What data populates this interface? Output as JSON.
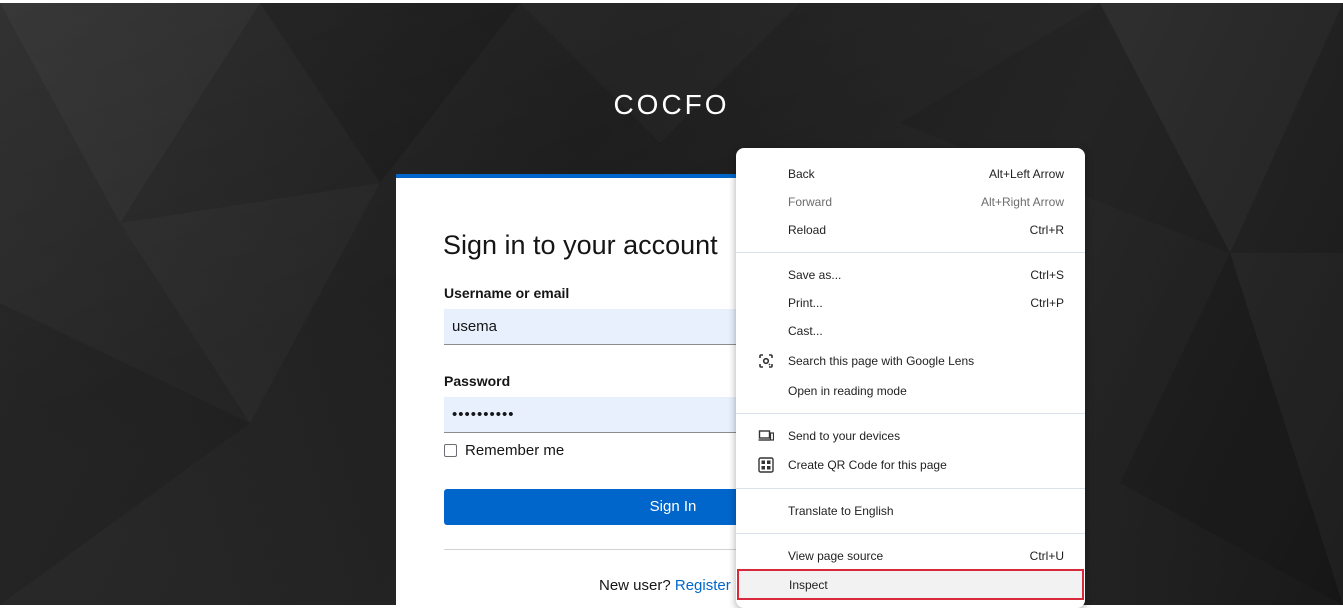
{
  "brand": "COCFO",
  "login": {
    "title": "Sign in to your account",
    "username_label": "Username or email",
    "username_value": "usema",
    "password_label": "Password",
    "password_value": "••••••••••",
    "remember_label": "Remember me",
    "signin_label": "Sign In",
    "new_user_text": "New user?",
    "register_label": "Register"
  },
  "colors": {
    "primary": "#0066cc",
    "highlight_border": "#d7283c"
  },
  "context_menu": {
    "items": [
      {
        "label": "Back",
        "shortcut": "Alt+Left Arrow"
      },
      {
        "label": "Forward",
        "shortcut": "Alt+Right Arrow"
      },
      {
        "label": "Reload",
        "shortcut": "Ctrl+R"
      },
      {
        "label": "Save as...",
        "shortcut": "Ctrl+S"
      },
      {
        "label": "Print...",
        "shortcut": "Ctrl+P"
      },
      {
        "label": "Cast...",
        "shortcut": ""
      },
      {
        "label": "Search this page with Google Lens",
        "shortcut": "",
        "icon": "google-lens-icon"
      },
      {
        "label": "Open in reading mode",
        "shortcut": ""
      },
      {
        "label": "Send to your devices",
        "shortcut": "",
        "icon": "devices-icon"
      },
      {
        "label": "Create QR Code for this page",
        "shortcut": "",
        "icon": "qr-code-icon"
      },
      {
        "label": "Translate to English",
        "shortcut": ""
      },
      {
        "label": "View page source",
        "shortcut": "Ctrl+U"
      },
      {
        "label": "Inspect",
        "shortcut": ""
      }
    ]
  }
}
